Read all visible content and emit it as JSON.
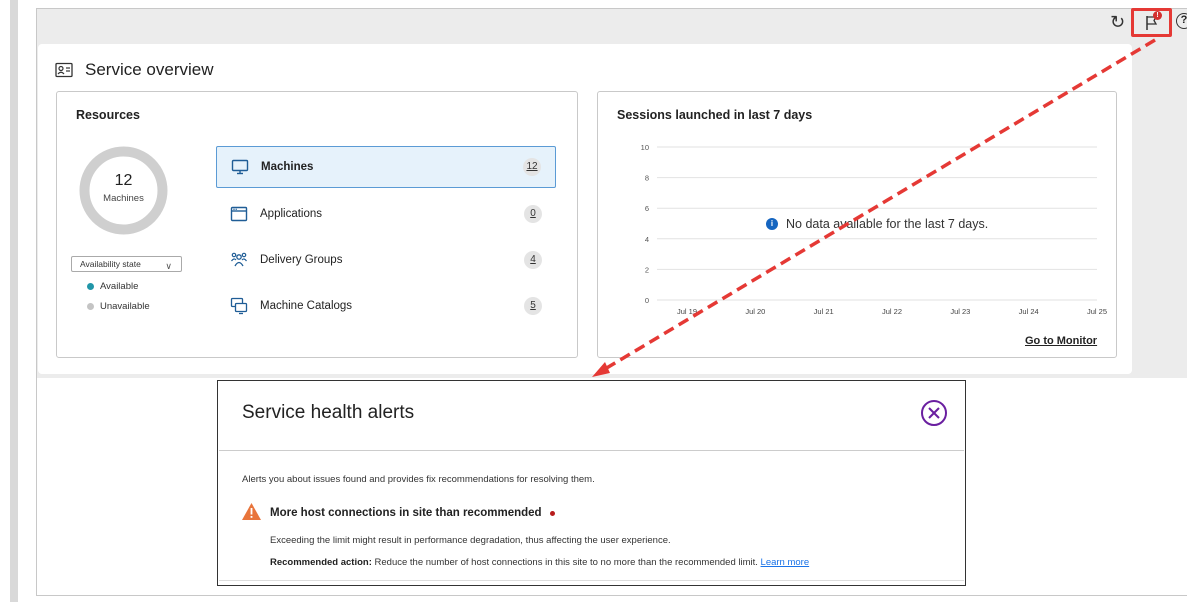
{
  "header": {
    "refresh_icon": "refresh-icon",
    "alerts_icon": "flag-icon",
    "alerts_badge": "!",
    "help_icon": "help-icon"
  },
  "overview": {
    "title": "Service overview",
    "resources": {
      "title": "Resources",
      "total": "12",
      "total_label": "Machines",
      "availability_select": "Availability state",
      "legend": [
        {
          "label": "Available",
          "color": "#2196a8"
        },
        {
          "label": "Unavailable",
          "color": "#c4c4c4"
        }
      ],
      "items": [
        {
          "label": "Machines",
          "count": "12",
          "icon": "monitor-icon"
        },
        {
          "label": "Applications",
          "count": "0",
          "icon": "window-icon"
        },
        {
          "label": "Delivery Groups",
          "count": "4",
          "icon": "group-icon"
        },
        {
          "label": "Machine Catalogs",
          "count": "5",
          "icon": "catalog-icon"
        }
      ]
    },
    "sessions": {
      "title": "Sessions launched in last 7 days",
      "no_data": "No data available for the last 7 days.",
      "link": "Go to Monitor"
    }
  },
  "chart_data": {
    "type": "line",
    "title": "Sessions launched in last 7 days",
    "categories": [
      "Jul 19",
      "Jul 20",
      "Jul 21",
      "Jul 22",
      "Jul 23",
      "Jul 24",
      "Jul 25"
    ],
    "series": [],
    "ylim": [
      0,
      10
    ],
    "yticks": [
      0,
      2,
      4,
      6,
      8,
      10
    ],
    "grid": true
  },
  "alerts_panel": {
    "title": "Service health alerts",
    "description": "Alerts you about issues found and provides fix recommendations for resolving them.",
    "alert": {
      "title": "More host connections in site than recommended",
      "detail": "Exceeding the limit might result in performance degradation, thus affecting the user experience.",
      "recommended_label": "Recommended action:",
      "recommended_text": " Reduce the number of host connections in this site to no more than the recommended limit. ",
      "learn_more": "Learn more"
    }
  }
}
